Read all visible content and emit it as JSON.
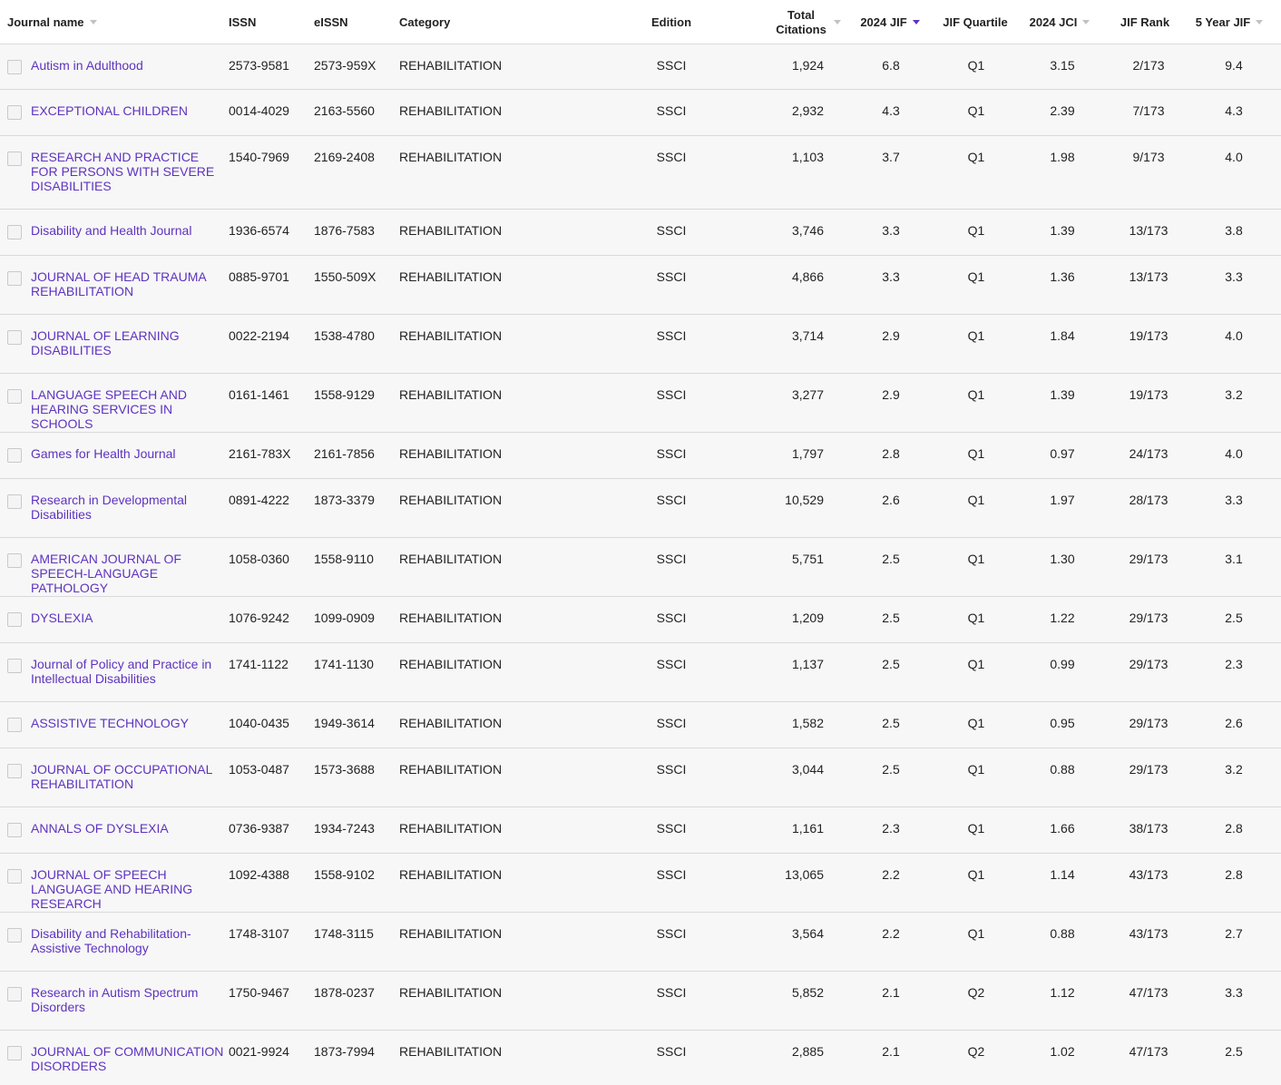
{
  "headers": {
    "journal_name": "Journal name",
    "issn": "ISSN",
    "eissn": "eISSN",
    "category": "Category",
    "edition": "Edition",
    "total_citations": "Total Citations",
    "jif": "2024 JIF",
    "jif_quartile": "JIF Quartile",
    "jci": "2024 JCI",
    "jif_rank": "JIF Rank",
    "five_year_jif": "5 Year JIF"
  },
  "sort": {
    "column": "2024 JIF",
    "direction": "descending"
  },
  "colors": {
    "accent": "#5e33bf",
    "row_bg": "#f7f7f7",
    "header_bg": "#ffffff"
  },
  "rows": [
    {
      "name": "Autism in Adulthood",
      "issn": "2573-9581",
      "eissn": "2573-959X",
      "category": "REHABILITATION",
      "edition": "SSCI",
      "citations": "1,924",
      "jif": "6.8",
      "quartile": "Q1",
      "jci": "3.15",
      "rank": "2/173",
      "jif5": "9.4"
    },
    {
      "name": "EXCEPTIONAL CHILDREN",
      "issn": "0014-4029",
      "eissn": "2163-5560",
      "category": "REHABILITATION",
      "edition": "SSCI",
      "citations": "2,932",
      "jif": "4.3",
      "quartile": "Q1",
      "jci": "2.39",
      "rank": "7/173",
      "jif5": "4.3"
    },
    {
      "name": "RESEARCH AND PRACTICE FOR PERSONS WITH SEVERE DISABILITIES",
      "issn": "1540-7969",
      "eissn": "2169-2408",
      "category": "REHABILITATION",
      "edition": "SSCI",
      "citations": "1,103",
      "jif": "3.7",
      "quartile": "Q1",
      "jci": "1.98",
      "rank": "9/173",
      "jif5": "4.0"
    },
    {
      "name": "Disability and Health Journal",
      "issn": "1936-6574",
      "eissn": "1876-7583",
      "category": "REHABILITATION",
      "edition": "SSCI",
      "citations": "3,746",
      "jif": "3.3",
      "quartile": "Q1",
      "jci": "1.39",
      "rank": "13/173",
      "jif5": "3.8"
    },
    {
      "name": "JOURNAL OF HEAD TRAUMA REHABILITATION",
      "issn": "0885-9701",
      "eissn": "1550-509X",
      "category": "REHABILITATION",
      "edition": "SSCI",
      "citations": "4,866",
      "jif": "3.3",
      "quartile": "Q1",
      "jci": "1.36",
      "rank": "13/173",
      "jif5": "3.3"
    },
    {
      "name": "JOURNAL OF LEARNING DISABILITIES",
      "issn": "0022-2194",
      "eissn": "1538-4780",
      "category": "REHABILITATION",
      "edition": "SSCI",
      "citations": "3,714",
      "jif": "2.9",
      "quartile": "Q1",
      "jci": "1.84",
      "rank": "19/173",
      "jif5": "4.0"
    },
    {
      "name": "LANGUAGE SPEECH AND HEARING SERVICES IN SCHOOLS",
      "issn": "0161-1461",
      "eissn": "1558-9129",
      "category": "REHABILITATION",
      "edition": "SSCI",
      "citations": "3,277",
      "jif": "2.9",
      "quartile": "Q1",
      "jci": "1.39",
      "rank": "19/173",
      "jif5": "3.2"
    },
    {
      "name": "Games for Health Journal",
      "issn": "2161-783X",
      "eissn": "2161-7856",
      "category": "REHABILITATION",
      "edition": "SSCI",
      "citations": "1,797",
      "jif": "2.8",
      "quartile": "Q1",
      "jci": "0.97",
      "rank": "24/173",
      "jif5": "4.0"
    },
    {
      "name": "Research in Developmental Disabilities",
      "issn": "0891-4222",
      "eissn": "1873-3379",
      "category": "REHABILITATION",
      "edition": "SSCI",
      "citations": "10,529",
      "jif": "2.6",
      "quartile": "Q1",
      "jci": "1.97",
      "rank": "28/173",
      "jif5": "3.3"
    },
    {
      "name": "AMERICAN JOURNAL OF SPEECH-LANGUAGE PATHOLOGY",
      "issn": "1058-0360",
      "eissn": "1558-9110",
      "category": "REHABILITATION",
      "edition": "SSCI",
      "citations": "5,751",
      "jif": "2.5",
      "quartile": "Q1",
      "jci": "1.30",
      "rank": "29/173",
      "jif5": "3.1"
    },
    {
      "name": "DYSLEXIA",
      "issn": "1076-9242",
      "eissn": "1099-0909",
      "category": "REHABILITATION",
      "edition": "SSCI",
      "citations": "1,209",
      "jif": "2.5",
      "quartile": "Q1",
      "jci": "1.22",
      "rank": "29/173",
      "jif5": "2.5"
    },
    {
      "name": "Journal of Policy and Practice in Intellectual Disabilities",
      "issn": "1741-1122",
      "eissn": "1741-1130",
      "category": "REHABILITATION",
      "edition": "SSCI",
      "citations": "1,137",
      "jif": "2.5",
      "quartile": "Q1",
      "jci": "0.99",
      "rank": "29/173",
      "jif5": "2.3"
    },
    {
      "name": "ASSISTIVE TECHNOLOGY",
      "issn": "1040-0435",
      "eissn": "1949-3614",
      "category": "REHABILITATION",
      "edition": "SSCI",
      "citations": "1,582",
      "jif": "2.5",
      "quartile": "Q1",
      "jci": "0.95",
      "rank": "29/173",
      "jif5": "2.6"
    },
    {
      "name": "JOURNAL OF OCCUPATIONAL REHABILITATION",
      "issn": "1053-0487",
      "eissn": "1573-3688",
      "category": "REHABILITATION",
      "edition": "SSCI",
      "citations": "3,044",
      "jif": "2.5",
      "quartile": "Q1",
      "jci": "0.88",
      "rank": "29/173",
      "jif5": "3.2"
    },
    {
      "name": "ANNALS OF DYSLEXIA",
      "issn": "0736-9387",
      "eissn": "1934-7243",
      "category": "REHABILITATION",
      "edition": "SSCI",
      "citations": "1,161",
      "jif": "2.3",
      "quartile": "Q1",
      "jci": "1.66",
      "rank": "38/173",
      "jif5": "2.8"
    },
    {
      "name": "JOURNAL OF SPEECH LANGUAGE AND HEARING RESEARCH",
      "issn": "1092-4388",
      "eissn": "1558-9102",
      "category": "REHABILITATION",
      "edition": "SSCI",
      "citations": "13,065",
      "jif": "2.2",
      "quartile": "Q1",
      "jci": "1.14",
      "rank": "43/173",
      "jif5": "2.8"
    },
    {
      "name": "Disability and Rehabilitation-Assistive Technology",
      "issn": "1748-3107",
      "eissn": "1748-3115",
      "category": "REHABILITATION",
      "edition": "SSCI",
      "citations": "3,564",
      "jif": "2.2",
      "quartile": "Q1",
      "jci": "0.88",
      "rank": "43/173",
      "jif5": "2.7"
    },
    {
      "name": "Research in Autism Spectrum Disorders",
      "issn": "1750-9467",
      "eissn": "1878-0237",
      "category": "REHABILITATION",
      "edition": "SSCI",
      "citations": "5,852",
      "jif": "2.1",
      "quartile": "Q2",
      "jci": "1.12",
      "rank": "47/173",
      "jif5": "3.3"
    },
    {
      "name": "JOURNAL OF COMMUNICATION DISORDERS",
      "issn": "0021-9924",
      "eissn": "1873-7994",
      "category": "REHABILITATION",
      "edition": "SSCI",
      "citations": "2,885",
      "jif": "2.1",
      "quartile": "Q2",
      "jci": "1.02",
      "rank": "47/173",
      "jif5": "2.5"
    }
  ]
}
